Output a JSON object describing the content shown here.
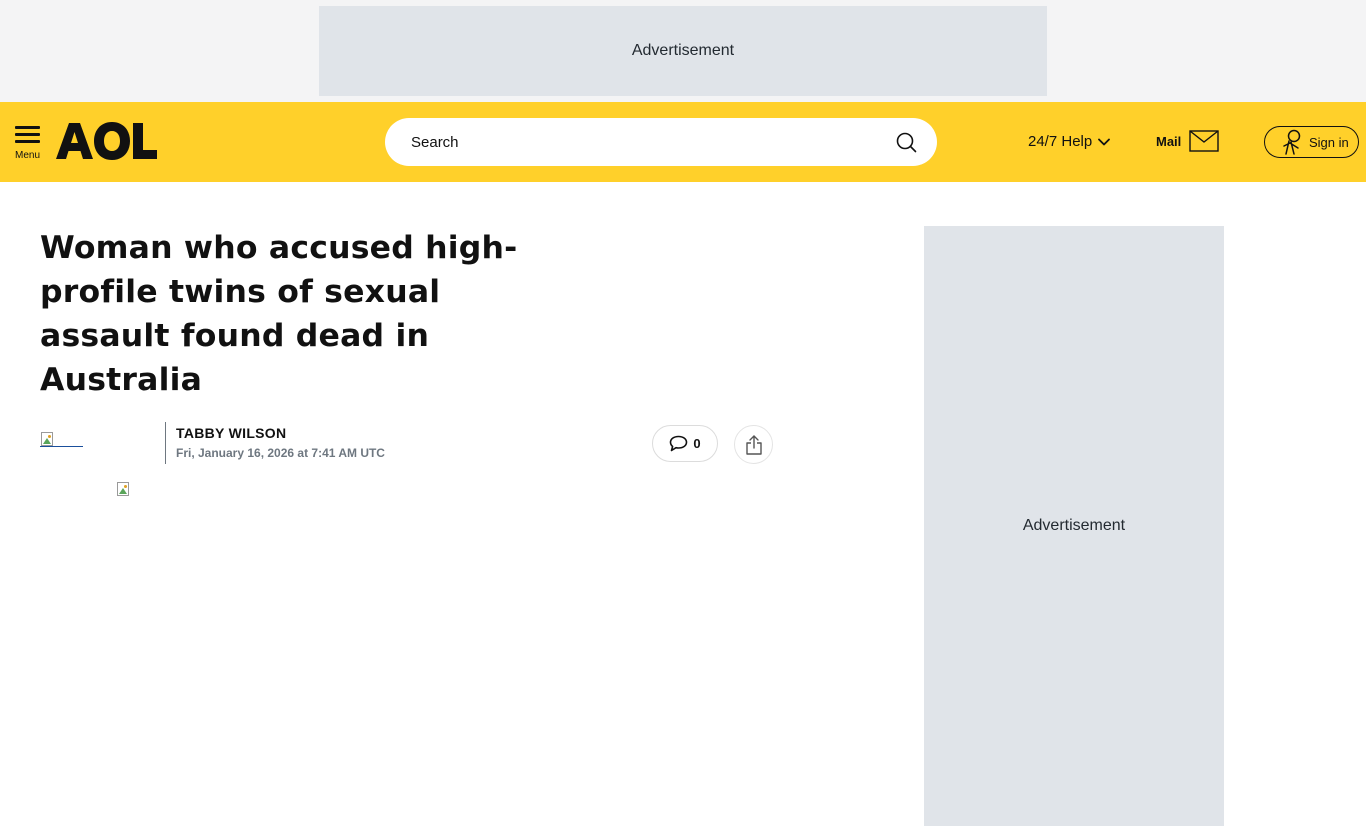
{
  "ads": {
    "top_label": "Advertisement",
    "side_label": "Advertisement"
  },
  "header": {
    "menu_label": "Menu",
    "logo_text": "AOL",
    "search_placeholder": "Search",
    "help_label": "24/7 Help",
    "mail_label": "Mail",
    "signin_label": "Sign in",
    "background_color": "#ffd02a"
  },
  "article": {
    "headline": "Woman who accused high-profile twins of sexual assault found dead in Australia",
    "author": "TABBY WILSON",
    "date": "Fri, January 16, 2026 at 7:41 AM UTC",
    "comment_count": "0"
  },
  "icons": [
    "hamburger-icon",
    "search-icon",
    "chevron-down-icon",
    "mail-icon",
    "user-icon",
    "comment-icon",
    "share-icon",
    "broken-image-icon"
  ]
}
